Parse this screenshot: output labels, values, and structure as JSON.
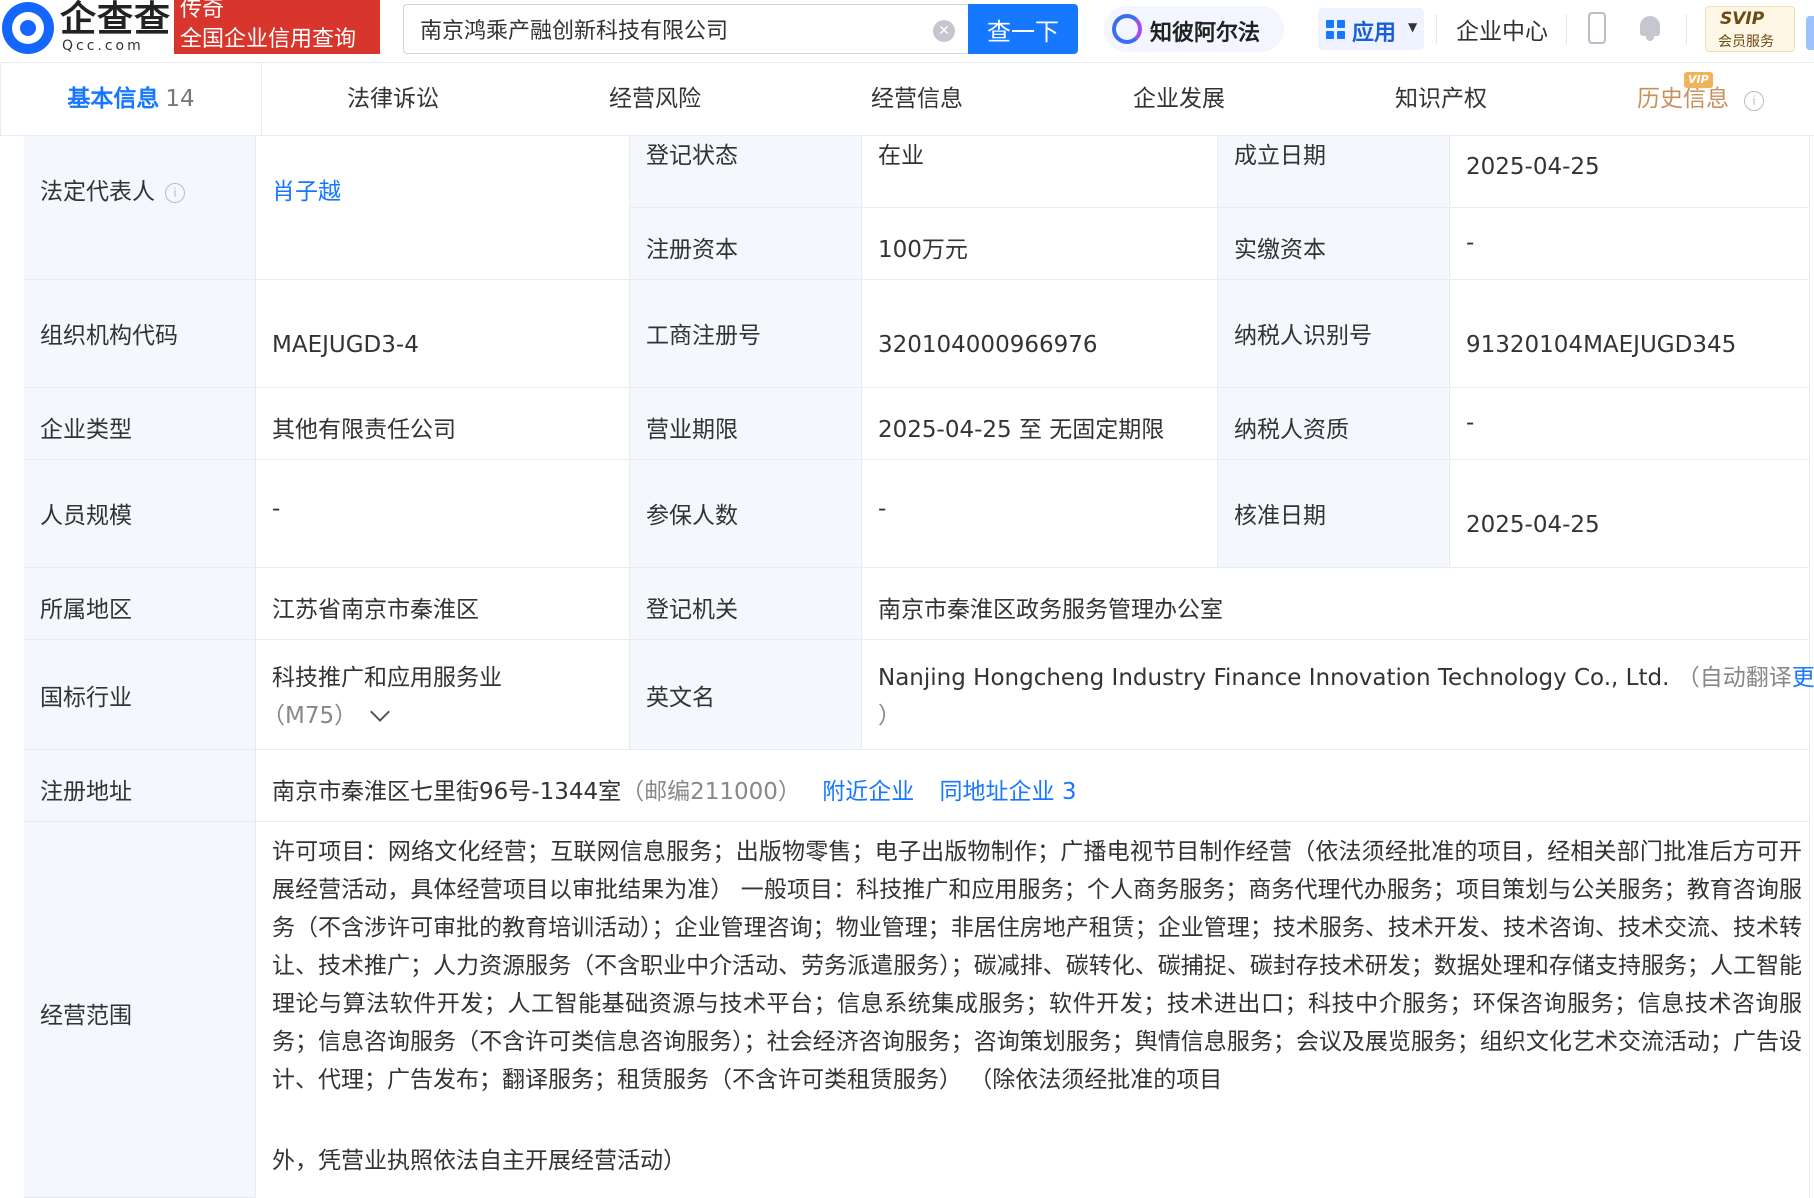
{
  "header": {
    "logo_cn": "企查查",
    "logo_en": "Qcc.com",
    "badge_line1": "传奇",
    "badge_line2": "全国企业信用查询",
    "search_value": "南京鸿乘产融创新科技有限公司",
    "clear_icon": "⊗",
    "search_button": "查一下",
    "zhibi_label": "知彼阿尔法",
    "apps_label": "应用",
    "enterprise_center": "企业中心",
    "svip_top": "SVIP",
    "svip_bottom": "会员服务"
  },
  "tabs": [
    {
      "label": "基本信息",
      "count": "14"
    },
    {
      "label": "法律诉讼"
    },
    {
      "label": "经营风险"
    },
    {
      "label": "经营信息"
    },
    {
      "label": "企业发展"
    },
    {
      "label": "知识产权"
    },
    {
      "label": "历史信息",
      "tag": "VIP"
    }
  ],
  "info": {
    "legal_rep_label": "法定代表人",
    "legal_rep_value": "肖子越",
    "reg_status_label": "登记状态",
    "reg_status_value": "在业",
    "found_date_label": "成立日期",
    "found_date_value": "2025-04-25",
    "reg_capital_label": "注册资本",
    "reg_capital_value": "100万元",
    "paid_capital_label": "实缴资本",
    "paid_capital_value": "-",
    "org_code_label": "组织机构代码",
    "org_code_value": "MAEJUGD3-4",
    "biz_reg_no_label": "工商注册号",
    "biz_reg_no_value": "320104000966976",
    "taxpayer_id_label": "纳税人识别号",
    "taxpayer_id_value": "91320104MAEJUGD345",
    "company_type_label": "企业类型",
    "company_type_value": "其他有限责任公司",
    "biz_term_label": "营业期限",
    "biz_term_value": "2025-04-25 至 无固定期限",
    "taxpayer_qual_label": "纳税人资质",
    "taxpayer_qual_value": "-",
    "staff_size_label": "人员规模",
    "staff_size_value": "-",
    "insured_label": "参保人数",
    "insured_value": "-",
    "approval_date_label": "核准日期",
    "approval_date_value": "2025-04-25",
    "region_label": "所属地区",
    "region_value": "江苏省南京市秦淮区",
    "reg_authority_label": "登记机关",
    "reg_authority_value": "南京市秦淮区政务服务管理办公室",
    "industry_label": "国标行业",
    "industry_value": "科技推广和应用服务业",
    "industry_code": "（M75）",
    "english_name_label": "英文名",
    "english_name_value": "Nanjing Hongcheng Industry Finance Innovation Technology Co., Ltd.",
    "english_name_note": "（自动翻译",
    "english_name_update": "更新",
    "english_name_close": "）",
    "address_label": "注册地址",
    "address_value": "南京市秦淮区七里街96号-1344室",
    "address_postcode": "（邮编211000）",
    "nearby_link": "附近企业",
    "same_address_link": "同地址企业 3",
    "scope_label": "经营范围",
    "scope_value": "许可项目：网络文化经营；互联网信息服务；出版物零售；电子出版物制作；广播电视节目制作经营（依法须经批准的项目，经相关部门批准后方可开展经营活动，具体经营项目以审批结果为准） 一般项目：科技推广和应用服务；个人商务服务；商务代理代办服务；项目策划与公关服务；教育咨询服务（不含涉许可审批的教育培训活动）；企业管理咨询；物业管理；非居住房地产租赁；企业管理；技术服务、技术开发、技术咨询、技术交流、技术转让、技术推广；人力资源服务（不含职业中介活动、劳务派遣服务）；碳减排、碳转化、碳捕捉、碳封存技术研发；数据处理和存储支持服务；人工智能理论与算法软件开发；人工智能基础资源与技术平台；信息系统集成服务；软件开发；技术进出口；科技中介服务；环保咨询服务；信息技术咨询服务；信息咨询服务（不含许可类信息咨询服务）；社会经济咨询服务；咨询策划服务；舆情信息服务；会议及展览服务；组织文化艺术交流活动；广告设计、代理；广告发布；翻译服务；租赁服务（不含许可类租赁服务） （除依法须经批准的项目",
    "scope_tail": "外，凭营业执照依法自主开展经营活动）"
  }
}
